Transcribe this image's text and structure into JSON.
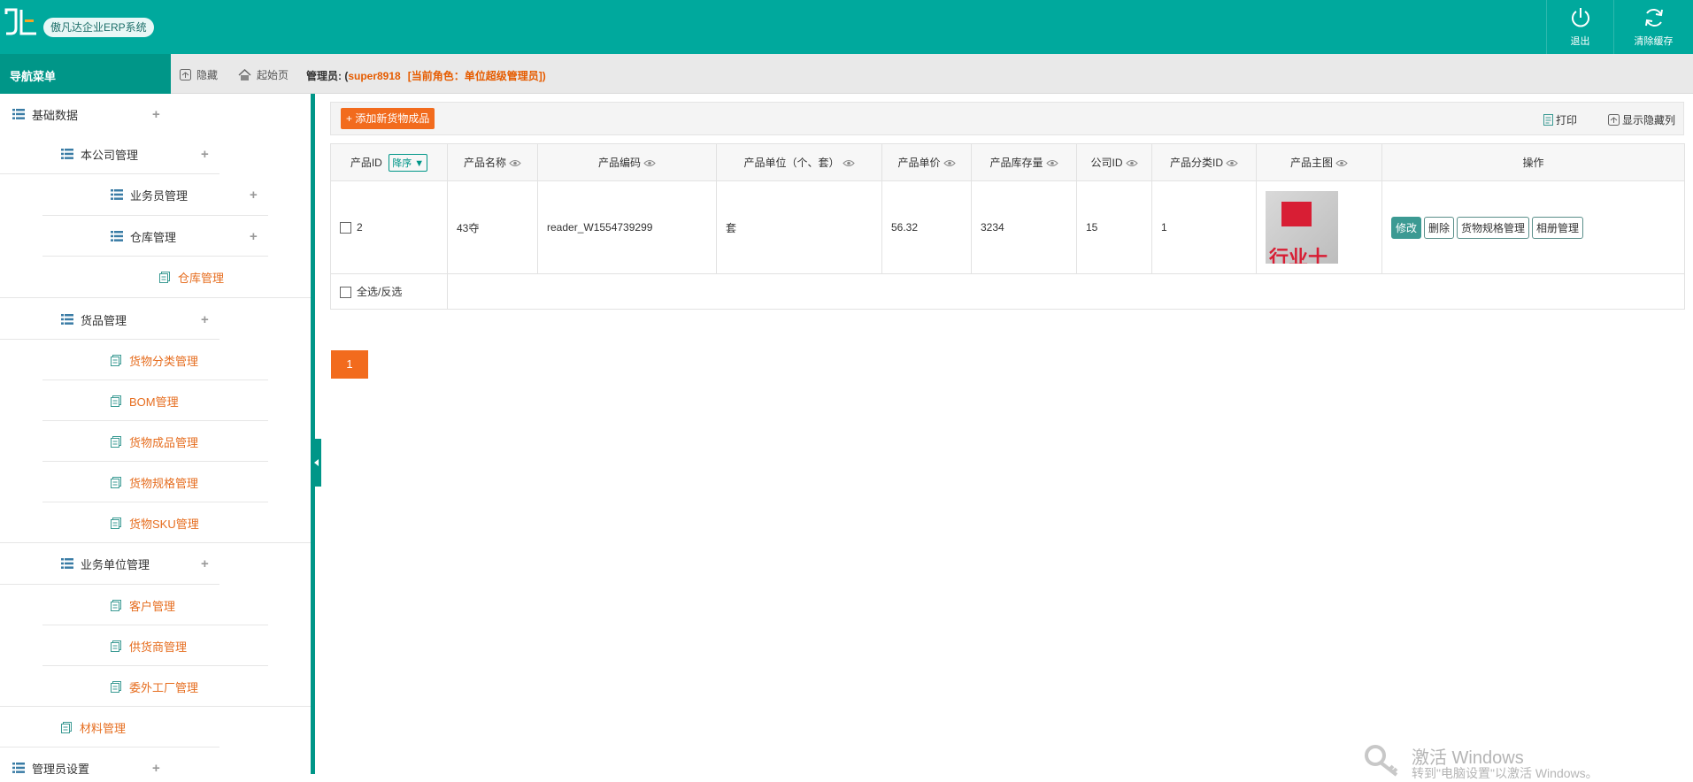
{
  "header": {
    "app_title": "傲凡达企业ERP系统",
    "actions": [
      {
        "label": "退出",
        "icon": "power-icon"
      },
      {
        "label": "清除缓存",
        "icon": "refresh-icon"
      }
    ]
  },
  "subbar": {
    "nav_title": "导航菜单",
    "hide_label": "隐藏",
    "home_label": "起始页",
    "admin_prefix": "管理员: (",
    "admin_name": "super8918",
    "role_text": "[当前角色：单位超级管理员])"
  },
  "sidebar": {
    "items": [
      {
        "label": "基础数据",
        "level": 0,
        "expand": "+"
      },
      {
        "label": "本公司管理",
        "level": 1,
        "expand": "+"
      },
      {
        "label": "业务员管理",
        "level": 2,
        "expand": "+"
      },
      {
        "label": "仓库管理",
        "level": 2,
        "expand": "+"
      },
      {
        "label": "仓库管理",
        "level": 3
      },
      {
        "label": "货品管理",
        "level": 1,
        "expand": "+"
      },
      {
        "label": "货物分类管理",
        "level": 2
      },
      {
        "label": "BOM管理",
        "level": 2
      },
      {
        "label": "货物成品管理",
        "level": 2
      },
      {
        "label": "货物规格管理",
        "level": 2
      },
      {
        "label": "货物SKU管理",
        "level": 2
      },
      {
        "label": "业务单位管理",
        "level": 1,
        "expand": "+"
      },
      {
        "label": "客户管理",
        "level": 2
      },
      {
        "label": "供货商管理",
        "level": 2
      },
      {
        "label": "委外工厂管理",
        "level": 2
      },
      {
        "label": "材料管理",
        "level": 1
      },
      {
        "label": "管理员设置",
        "level": 0,
        "expand": "+"
      }
    ]
  },
  "toolbar": {
    "add_label": "+ 添加新货物成品",
    "print_label": "打印",
    "show_hidden_label": "显示隐藏列"
  },
  "table": {
    "sort_label": "降序",
    "columns": [
      "产品ID",
      "产品名称",
      "产品编码",
      "产品单位（个、套）",
      "产品单价",
      "产品库存量",
      "公司ID",
      "产品分类ID",
      "产品主图",
      "操作"
    ],
    "rows": [
      {
        "id": "2",
        "name": "43夺",
        "code": "reader_W1554739299",
        "unit": "套",
        "price": "56.32",
        "stock": "3234",
        "company_id": "15",
        "category_id": "1",
        "image_text": "行业十"
      }
    ],
    "row_actions": [
      "修改",
      "删除",
      "货物规格管理",
      "相册管理"
    ],
    "select_all_label": "全选/反选"
  },
  "pagination": {
    "current": "1"
  },
  "watermark": {
    "line1": "激活 Windows",
    "line2": "转到\"电脑设置\"以激活 Windows。"
  },
  "colors": {
    "primary": "#00a99d",
    "nav": "#009688",
    "accent": "#f26b1d"
  }
}
